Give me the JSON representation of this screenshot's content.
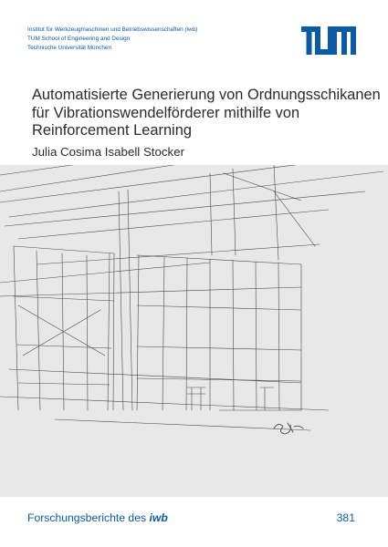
{
  "institution": {
    "line1_main": "Institut für Werkzeugmaschinen und Betriebswissenschaften",
    "line1_abbrev": "(iwb)",
    "line2": "TUM School of Engineering and Design",
    "line3": "Technische Universität München"
  },
  "logo": {
    "name": "tum-logo",
    "color": "#0b5aa6"
  },
  "title_lines": [
    "Automatisierte Generierung von Ordnungsschikanen",
    "für Vibrationswendelförderer mithilfe von",
    "Reinforcement Learning"
  ],
  "author": "Julia Cosima Isabell Stocker",
  "sketch_signature": "Stef 17",
  "series": {
    "name": "Forschungsberichte des",
    "abbrev": "iwb"
  },
  "volume_number": "381",
  "colors": {
    "accent": "#0b5aa6",
    "text": "#2b2b2b",
    "background": "#e8e8e8",
    "sketch": "#4a4a4a"
  }
}
